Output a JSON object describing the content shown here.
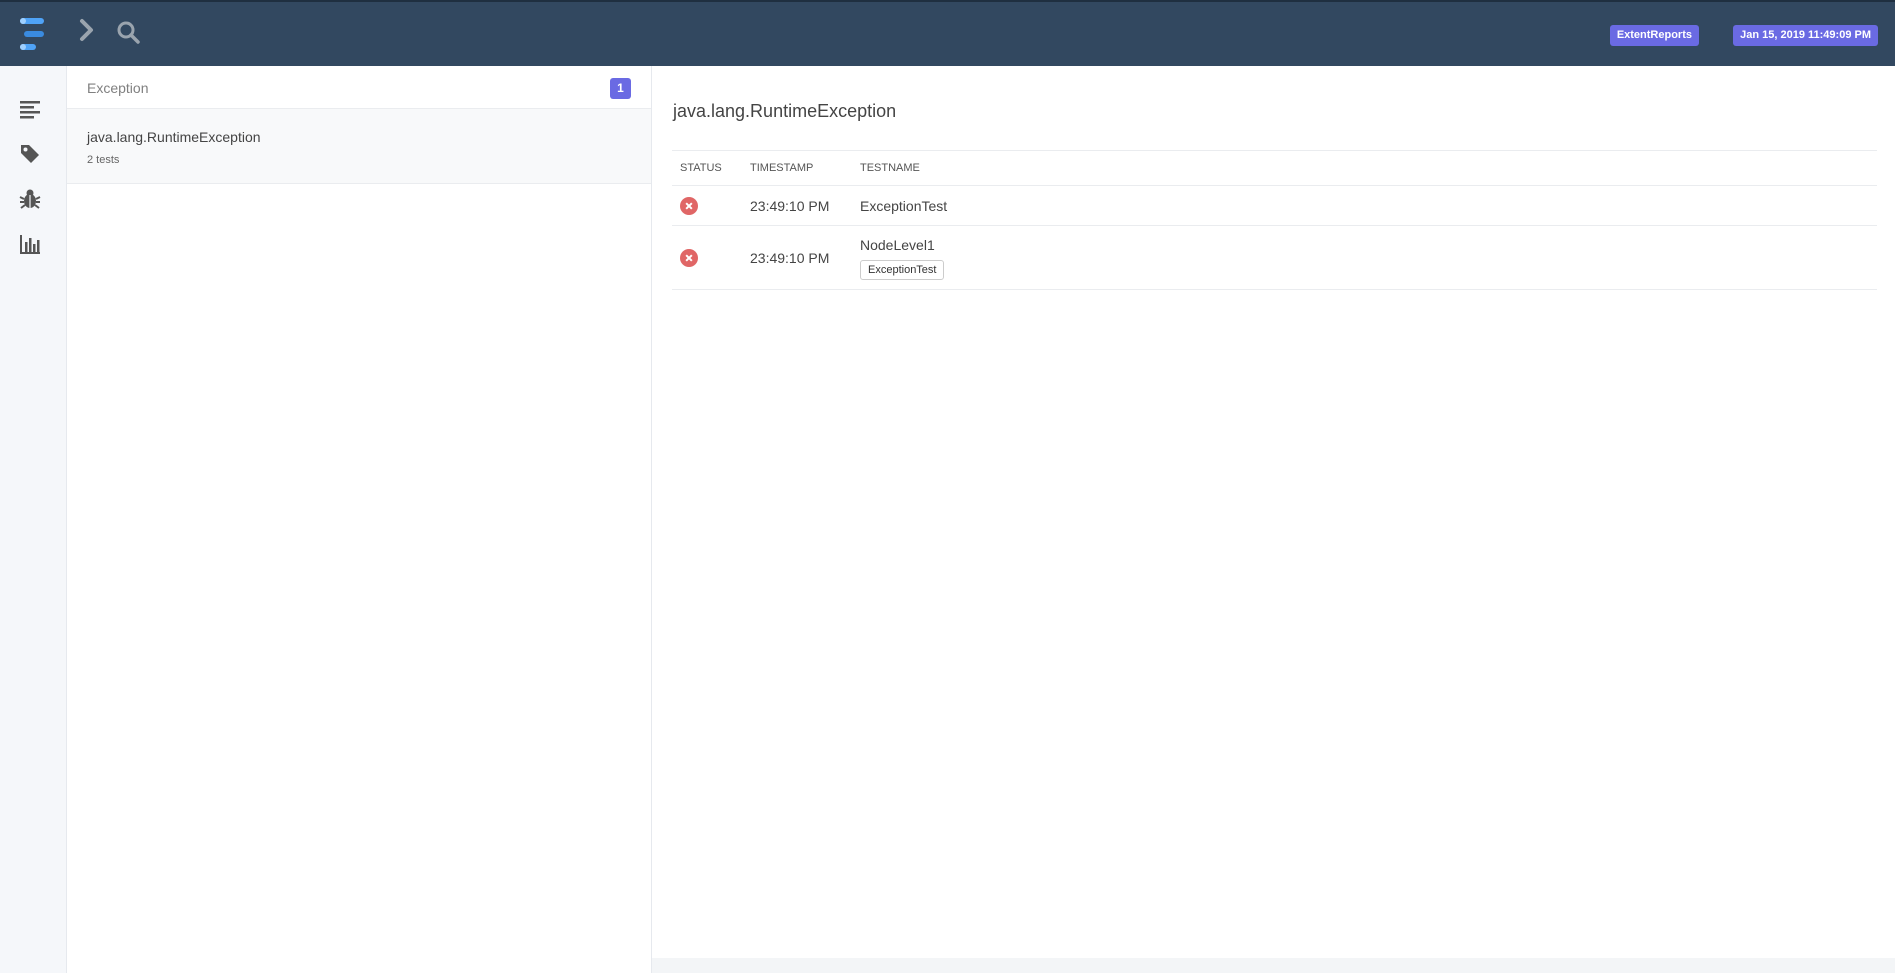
{
  "topbar": {
    "app_name": "ExtentReports",
    "report_date": "Jan 15, 2019 11:49:09 PM"
  },
  "sidebar": {
    "items": [
      {
        "icon": "list-icon"
      },
      {
        "icon": "tag-icon"
      },
      {
        "icon": "bug-icon"
      },
      {
        "icon": "bar-chart-icon"
      }
    ]
  },
  "list_panel": {
    "title": "Exception",
    "count": "1",
    "items": [
      {
        "title": "java.lang.RuntimeException",
        "subtitle": "2 tests"
      }
    ]
  },
  "detail": {
    "title": "java.lang.RuntimeException",
    "columns": [
      "STATUS",
      "TIMESTAMP",
      "TESTNAME"
    ],
    "rows": [
      {
        "status": "fail",
        "timestamp": "23:49:10 PM",
        "testname": "ExceptionTest",
        "parent": ""
      },
      {
        "status": "fail",
        "timestamp": "23:49:10 PM",
        "testname": "NodeLevel1",
        "parent": "ExceptionTest"
      }
    ]
  },
  "colors": {
    "topbar": "#324860",
    "accent": "#6a6ae3",
    "fail": "#e06666"
  }
}
